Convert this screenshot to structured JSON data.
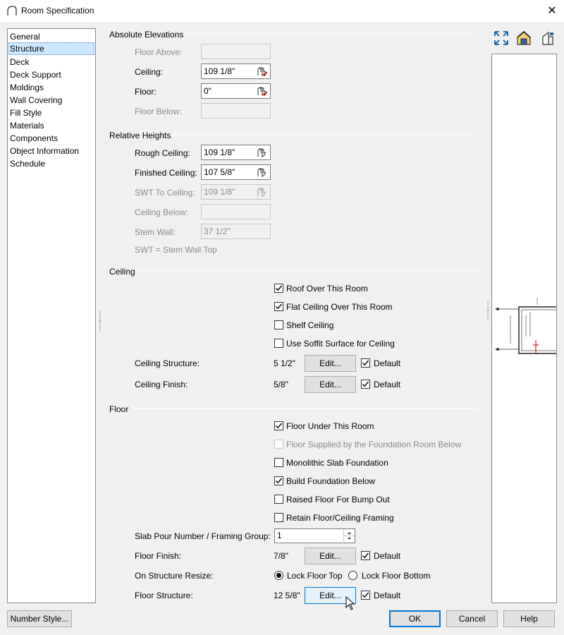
{
  "window": {
    "title": "Room Specification",
    "close_icon": "close-icon"
  },
  "sidebar": {
    "items": [
      {
        "label": "General"
      },
      {
        "label": "Structure"
      },
      {
        "label": "Deck"
      },
      {
        "label": "Deck Support"
      },
      {
        "label": "Moldings"
      },
      {
        "label": "Wall Covering"
      },
      {
        "label": "Fill Style"
      },
      {
        "label": "Materials"
      },
      {
        "label": "Components"
      },
      {
        "label": "Object Information"
      },
      {
        "label": "Schedule"
      }
    ],
    "selected": "Structure"
  },
  "absolute": {
    "heading": "Absolute Elevations",
    "floor_above_label": "Floor Above:",
    "floor_above_value": "",
    "ceiling_label": "Ceiling:",
    "ceiling_value": "109 1/8\"",
    "floor_label": "Floor:",
    "floor_value": "0\"",
    "floor_below_label": "Floor Below:",
    "floor_below_value": ""
  },
  "relative": {
    "heading": "Relative Heights",
    "rough_ceiling_label": "Rough Ceiling:",
    "rough_ceiling_value": "109 1/8\"",
    "finished_ceiling_label": "Finished Ceiling:",
    "finished_ceiling_value": "107 5/8\"",
    "swt_label": "SWT To Ceiling:",
    "swt_value": "109 1/8\"",
    "ceiling_below_label": "Ceiling Below:",
    "ceiling_below_value": "",
    "stem_wall_label": "Stem Wall:",
    "stem_wall_value": "37 1/2\"",
    "note": "SWT = Stem Wall Top"
  },
  "ceiling": {
    "heading": "Ceiling",
    "roof_over": {
      "label": "Roof Over This Room",
      "checked": true
    },
    "flat_ceiling": {
      "label": "Flat Ceiling Over This Room",
      "checked": true
    },
    "shelf_ceiling": {
      "label": "Shelf Ceiling",
      "checked": false
    },
    "soffit": {
      "label": "Use Soffit Surface for Ceiling",
      "checked": false
    },
    "structure_label": "Ceiling Structure:",
    "structure_value": "5 1/2\"",
    "finish_label": "Ceiling Finish:",
    "finish_value": "5/8\"",
    "edit_label": "Edit...",
    "default_label": "Default"
  },
  "floor": {
    "heading": "Floor",
    "floor_under": {
      "label": "Floor Under This Room",
      "checked": true
    },
    "floor_supplied": {
      "label": "Floor Supplied by the Foundation Room Below",
      "checked": false,
      "disabled": true
    },
    "monolithic": {
      "label": "Monolithic Slab Foundation",
      "checked": false
    },
    "build_foundation": {
      "label": "Build Foundation Below",
      "checked": true
    },
    "raised_floor": {
      "label": "Raised Floor For Bump Out",
      "checked": false
    },
    "retain_floor": {
      "label": "Retain Floor/Ceiling Framing",
      "checked": false
    },
    "slab_label": "Slab Pour Number / Framing Group:",
    "slab_value": "1",
    "finish_label": "Floor Finish:",
    "finish_value": "7/8\"",
    "resize_label": "On Structure Resize:",
    "lock_top_label": "Lock Floor Top",
    "lock_bottom_label": "Lock Floor Bottom",
    "structure_label": "Floor Structure:",
    "structure_value": "12 5/8\"",
    "edit_label": "Edit...",
    "default_label": "Default"
  },
  "footer": {
    "number_style": "Number Style...",
    "ok": "OK",
    "cancel": "Cancel",
    "help": "Help"
  }
}
